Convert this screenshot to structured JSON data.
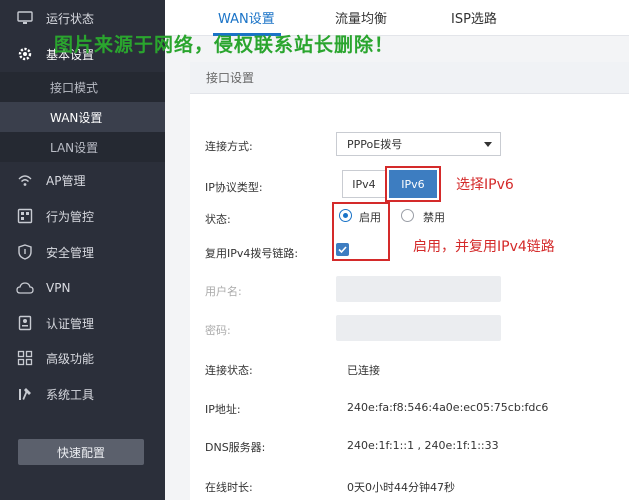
{
  "sidebar": {
    "items": [
      {
        "key": "run-status",
        "label": "运行状态",
        "icon": "monitor-icon"
      },
      {
        "key": "basic-settings",
        "label": "基本设置",
        "icon": "gear-icon"
      },
      {
        "key": "ap-manage",
        "label": "AP管理",
        "icon": "wifi-icon"
      },
      {
        "key": "behavior",
        "label": "行为管控",
        "icon": "grid-icon"
      },
      {
        "key": "security",
        "label": "安全管理",
        "icon": "shield-icon"
      },
      {
        "key": "vpn",
        "label": "VPN",
        "icon": "cloud-icon"
      },
      {
        "key": "auth",
        "label": "认证管理",
        "icon": "badge-icon"
      },
      {
        "key": "advanced",
        "label": "高级功能",
        "icon": "apps-icon"
      },
      {
        "key": "tools",
        "label": "系统工具",
        "icon": "tools-icon"
      }
    ],
    "sub_items": [
      {
        "label": "接口模式"
      },
      {
        "label": "WAN设置"
      },
      {
        "label": "LAN设置"
      }
    ],
    "quick_button": "快速配置"
  },
  "tabs": [
    {
      "label": "WAN设置"
    },
    {
      "label": "流量均衡"
    },
    {
      "label": "ISP选路"
    }
  ],
  "watermark": "图片来源于网络，侵权联系站长删除！",
  "panel": {
    "title": "接口设置",
    "connection_type_label": "连接方式:",
    "connection_type_value": "PPPoE拨号",
    "ip_protocol_label": "IP协议类型:",
    "ipv4": "IPv4",
    "ipv6": "IPv6",
    "status_label": "状态:",
    "enable": "启用",
    "disable": "禁用",
    "reuse_label": "复用IPv4拨号链路:",
    "username_label": "用户名:",
    "password_label": "密码:",
    "conn_status_label": "连接状态:",
    "conn_status_value": "已连接",
    "ip_label": "IP地址:",
    "ip_value": "240e:fa:f8:546:4a0e:ec05:75cb:fdc6",
    "dns_label": "DNS服务器:",
    "dns_value": "240e:1f:1::1 , 240e:1f:1::33",
    "online_label": "在线时长:",
    "online_value": "0天0小时44分钟47秒"
  },
  "annotations": {
    "select_ipv6": "选择IPv6",
    "enable_reuse": "启用，并复用IPv4链路"
  },
  "colors": {
    "accent": "#1a73c7",
    "annotation": "#d42a2a",
    "watermark": "#2aa52e",
    "sidebar_bg": "#2b2f3a"
  }
}
